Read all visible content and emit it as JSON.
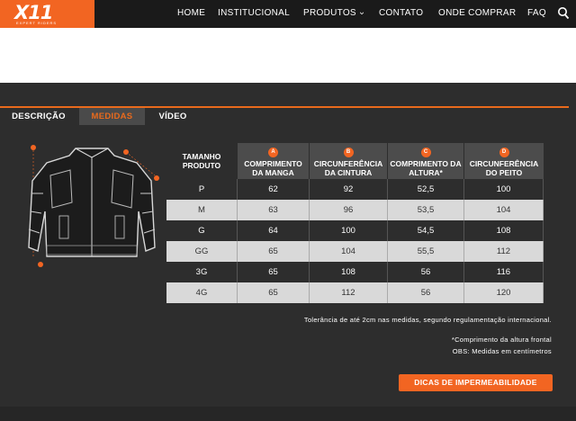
{
  "brand": {
    "name": "X11",
    "tagline": "EXPERT RIDERS"
  },
  "nav": {
    "items": [
      "HOME",
      "INSTITUCIONAL",
      "PRODUTOS",
      "CONTATO",
      "ONDE COMPRAR",
      "FAQ"
    ],
    "products_caret": "‹"
  },
  "tabs": [
    "DESCRIÇÃO",
    "MEDIDAS",
    "VÍDEO"
  ],
  "active_tab": "MEDIDAS",
  "table": {
    "corner_header": "TAMANHO PRODUTO",
    "columns": [
      {
        "badge": "A",
        "label": "COMPRIMENTO DA MANGA"
      },
      {
        "badge": "B",
        "label": "CIRCUNFERÊNCIA DA CINTURA"
      },
      {
        "badge": "C",
        "label": "COMPRIMENTO DA ALTURA*"
      },
      {
        "badge": "D",
        "label": "CIRCUNFERÊNCIA DO PEITO"
      }
    ],
    "rows": [
      {
        "size": "P",
        "values": [
          "62",
          "92",
          "52,5",
          "100"
        ]
      },
      {
        "size": "M",
        "values": [
          "63",
          "96",
          "53,5",
          "104"
        ]
      },
      {
        "size": "G",
        "values": [
          "64",
          "100",
          "54,5",
          "108"
        ]
      },
      {
        "size": "GG",
        "values": [
          "65",
          "104",
          "55,5",
          "112"
        ]
      },
      {
        "size": "3G",
        "values": [
          "65",
          "108",
          "56",
          "116"
        ]
      },
      {
        "size": "4G",
        "values": [
          "65",
          "112",
          "56",
          "120"
        ]
      }
    ]
  },
  "notes": {
    "tolerance": "Tolerância de até 2cm nas medidas, segundo regulamentação internacional.",
    "footnote": "*Comprimento da altura frontal",
    "obs": "OBS: Medidas em centímetros"
  },
  "cta": {
    "label": "DICAS DE IMPERMEABILIDADE"
  },
  "colors": {
    "accent": "#f26522",
    "background": "#2d2d2d",
    "header": "#1a1a1a"
  }
}
